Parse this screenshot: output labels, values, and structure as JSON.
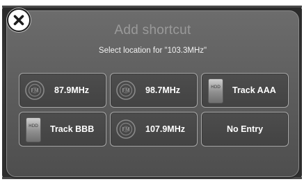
{
  "dialog": {
    "title": "Add shortcut",
    "subtitle": "Select location for \"103.3MHz\""
  },
  "close_button": {
    "icon": "close-icon"
  },
  "tiles": [
    {
      "icon": "fm-radio-icon",
      "label": "87.9MHz"
    },
    {
      "icon": "fm-radio-icon",
      "label": "98.7MHz"
    },
    {
      "icon": "hdd-icon",
      "label": "Track AAA"
    },
    {
      "icon": "hdd-icon",
      "label": "Track BBB"
    },
    {
      "icon": "fm-radio-icon",
      "label": "107.9MHz"
    },
    {
      "icon": "none",
      "label": "No Entry"
    }
  ],
  "colors": {
    "dialog_bg": "#5b5b5b",
    "tile_bg": "#4d4d4d",
    "tile_border": "#a9a9a9",
    "title_text": "#9a9a9a",
    "label_text": "#ffffff"
  }
}
